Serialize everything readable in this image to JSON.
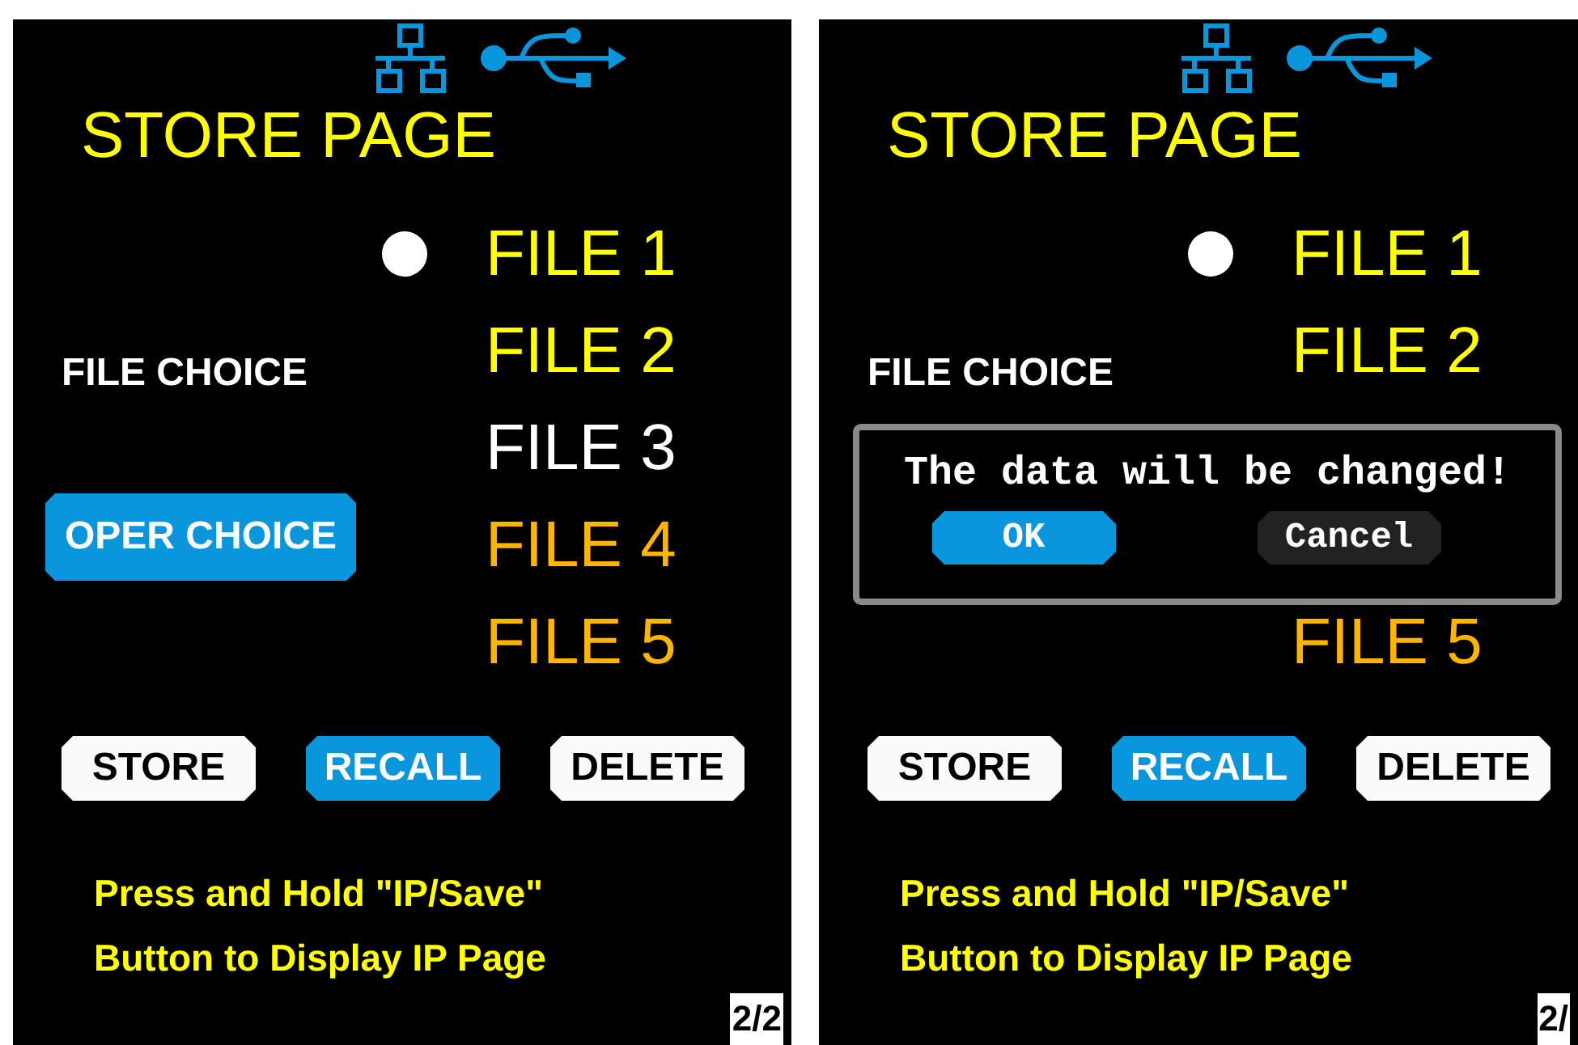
{
  "screens": [
    {
      "title": "STORE PAGE",
      "choices": [
        {
          "label": "FILE CHOICE",
          "selected": false
        },
        {
          "label": "OPER CHOICE",
          "selected": true
        }
      ],
      "files": [
        {
          "label": "FILE 1",
          "selected": true,
          "color": "#ffff00"
        },
        {
          "label": "FILE 2",
          "selected": false,
          "color": "#ffff00"
        },
        {
          "label": "FILE 3",
          "selected": false,
          "color": "#ffffff"
        },
        {
          "label": "FILE 4",
          "selected": false,
          "color": "#ffb400"
        },
        {
          "label": "FILE 5",
          "selected": false,
          "color": "#ffb400"
        }
      ],
      "buttons": [
        {
          "label": "STORE",
          "selected": false
        },
        {
          "label": "RECALL",
          "selected": true
        },
        {
          "label": "DELETE",
          "selected": false
        }
      ],
      "hint": "Press and Hold \"IP/Save\" Button to Display IP Page",
      "page": "2/2"
    },
    {
      "title": "STORE PAGE",
      "choices": [
        {
          "label": "FILE CHOICE",
          "selected": false
        }
      ],
      "files": [
        {
          "label": "FILE 1",
          "selected": true,
          "color": "#ffff00"
        },
        {
          "label": "FILE 2",
          "selected": false,
          "color": "#ffff00"
        }
      ],
      "dialog": {
        "message": "The data will be changed!",
        "buttons": [
          {
            "label": "OK",
            "selected": true
          },
          {
            "label": "Cancel",
            "selected": false
          }
        ]
      },
      "files_below_dialog": [
        {
          "label": "FILE 5",
          "selected": false,
          "color": "#ffb400"
        }
      ],
      "buttons": [
        {
          "label": "STORE",
          "selected": false
        },
        {
          "label": "RECALL",
          "selected": true
        },
        {
          "label": "DELETE",
          "selected": false
        }
      ],
      "hint": "Press and Hold \"IP/Save\" Button to Display IP Page",
      "page": "2/"
    }
  ]
}
